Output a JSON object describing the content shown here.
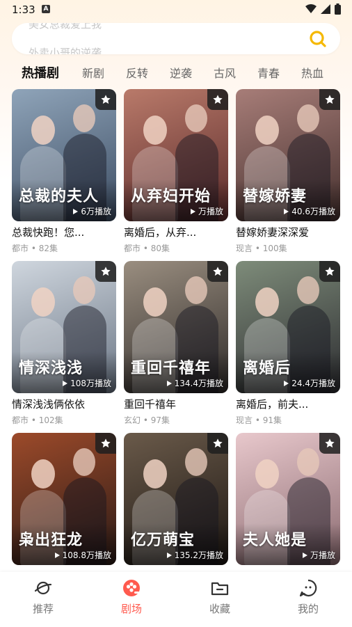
{
  "status": {
    "time": "1:33",
    "badge": "A"
  },
  "search": {
    "hints": [
      "美女总裁爱上我",
      "外卖小哥的逆袭"
    ]
  },
  "tabs": [
    "热播剧",
    "新剧",
    "反转",
    "逆袭",
    "古风",
    "青春",
    "热血"
  ],
  "active_tab": "热播剧",
  "dramas": [
    {
      "title": "总裁快跑！您...",
      "meta": "都市 • 82集",
      "plays": "6万播放",
      "poster_text": "总裁的夫人",
      "colors": [
        "#8fa4b9",
        "#3d4d63"
      ]
    },
    {
      "title": "离婚后，从弃...",
      "meta": "都市 • 80集",
      "plays": "万播放",
      "poster_text": "从弃妇开始",
      "colors": [
        "#b97a6a",
        "#5a2a2a"
      ]
    },
    {
      "title": "替嫁娇妻深深爱",
      "meta": "现言 • 100集",
      "plays": "40.6万播放",
      "poster_text": "替嫁娇妻",
      "colors": [
        "#a77d78",
        "#45302e"
      ]
    },
    {
      "title": "情深浅浅俩依依",
      "meta": "都市 • 102集",
      "plays": "108万播放",
      "poster_text": "情深浅浅",
      "colors": [
        "#cfd6de",
        "#6b7685"
      ]
    },
    {
      "title": "重回千禧年",
      "meta": "玄幻 • 97集",
      "plays": "134.4万播放",
      "poster_text": "重回千禧年",
      "colors": [
        "#9a8e80",
        "#2e2a28"
      ]
    },
    {
      "title": "离婚后，前夫...",
      "meta": "现言 • 91集",
      "plays": "24.4万播放",
      "poster_text": "离婚后",
      "colors": [
        "#7e8c7a",
        "#2c2c30"
      ]
    },
    {
      "title": "",
      "meta": "",
      "plays": "108.8万播放",
      "poster_text": "枭出狂龙",
      "colors": [
        "#9c4a2a",
        "#2a1a16"
      ]
    },
    {
      "title": "",
      "meta": "",
      "plays": "135.2万播放",
      "poster_text": "亿万萌宝",
      "colors": [
        "#6a5a4a",
        "#1c1612"
      ]
    },
    {
      "title": "",
      "meta": "",
      "plays": "万播放",
      "poster_text": "夫人她是",
      "colors": [
        "#e8c8cc",
        "#8a6a70"
      ]
    }
  ],
  "nav": [
    {
      "label": "推荐",
      "icon": "planet-icon"
    },
    {
      "label": "剧场",
      "icon": "theater-icon"
    },
    {
      "label": "收藏",
      "icon": "folder-icon"
    },
    {
      "label": "我的",
      "icon": "face-icon"
    }
  ],
  "active_nav": "剧场",
  "colors": {
    "accent": "#ff5a4e",
    "search_icon": "#f5b800"
  }
}
